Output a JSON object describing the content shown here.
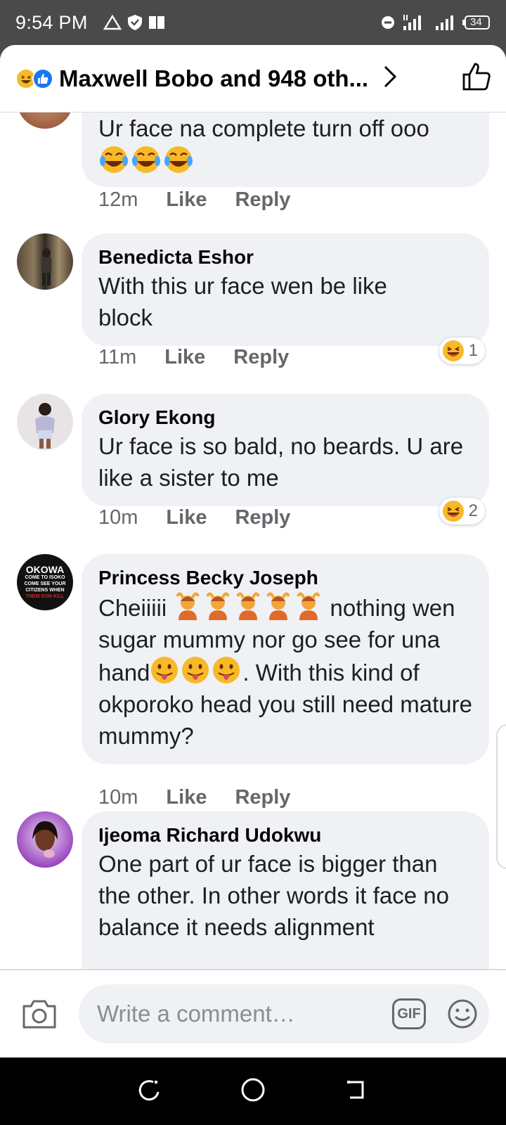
{
  "status_bar": {
    "time": "9:54 PM",
    "battery": "34",
    "icons_left": [
      "warning-triangle-icon",
      "shield-icon",
      "book-icon"
    ],
    "icons_right": [
      "do-not-disturb-icon",
      "signal-4g-icon",
      "signal-icon",
      "battery-icon"
    ]
  },
  "header": {
    "title": "Maxwell Bobo and 948 oth...",
    "reactions": [
      "haha",
      "like"
    ]
  },
  "comments": [
    {
      "name": "",
      "text": "Ur face na complete turn off ooo",
      "time": "12m",
      "like": "Like",
      "reply": "Reply",
      "reaction_count": ""
    },
    {
      "name": "Benedicta Eshor",
      "text": "With this ur face wen be like block",
      "time": "11m",
      "like": "Like",
      "reply": "Reply",
      "reaction_count": "1"
    },
    {
      "name": "Glory Ekong",
      "text": "Ur face is so bald, no beards. U are like a sister to me",
      "time": "10m",
      "like": "Like",
      "reply": "Reply",
      "reaction_count": "2"
    },
    {
      "name": "Princess Becky Joseph",
      "text_a": "Cheiiiii",
      "text_b": "nothing wen sugar mummy nor go see for una hand",
      "text_c": ". With this kind of okporoko head you still need mature mummy?",
      "time": "10m",
      "like": "Like",
      "reply": "Reply",
      "avatar_text": [
        "OKOWA",
        "COME TO ISOKO",
        "COME SEE YOUR",
        "CITIZENS WHEN",
        "THEM DON KILL"
      ]
    },
    {
      "name": "Ijeoma Richard Udokwu",
      "text": "One part of ur face is bigger than the other. In other words it face no balance it needs alignment"
    }
  ],
  "composer": {
    "placeholder": "Write a comment…",
    "gif_label": "GIF"
  },
  "colors": {
    "bubble": "#eff1f4",
    "meta_text": "#65676b",
    "like_blue": "#1877f2",
    "haha_yellow": "#f7b928"
  }
}
